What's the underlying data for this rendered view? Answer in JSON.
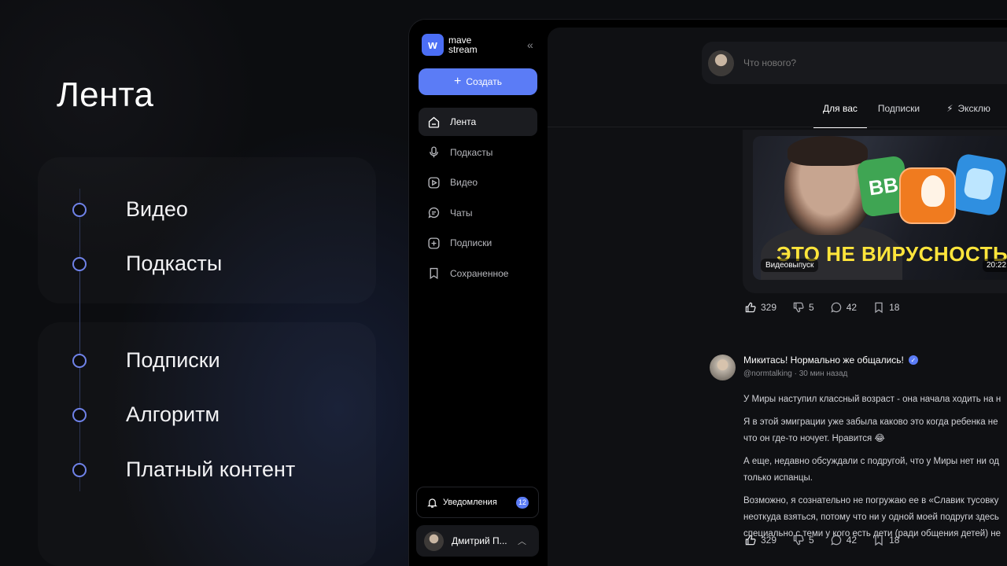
{
  "slide": {
    "title": "Лента",
    "items": [
      "Видео",
      "Подкасты",
      "Подписки",
      "Алгоритм",
      "Платный контент"
    ]
  },
  "app": {
    "logo": {
      "icon": "wave-logo-icon",
      "line1": "mave",
      "line2": "stream"
    },
    "collapse_label": "«",
    "create_label": "Создать",
    "nav": [
      {
        "label": "Лента",
        "icon": "home-icon",
        "active": true
      },
      {
        "label": "Подкасты",
        "icon": "microphone-icon"
      },
      {
        "label": "Видео",
        "icon": "play-icon"
      },
      {
        "label": "Чаты",
        "icon": "chat-icon"
      },
      {
        "label": "Подписки",
        "icon": "plus-square-icon"
      },
      {
        "label": "Сохраненное",
        "icon": "bookmark-icon"
      }
    ],
    "notifications": {
      "label": "Уведомления",
      "count": "12"
    },
    "user": {
      "name": "Дмитрий П..."
    },
    "accent": "#5b7cf6"
  },
  "feed": {
    "compose_placeholder": "Что нового?",
    "tabs": [
      "Для вас",
      "Подписки",
      "Эксклю"
    ],
    "video": {
      "headline": "ЭТО НЕ ВИРУСНОСТЬ",
      "badge": "Видеовыпуск",
      "duration": "20:22",
      "app_letters": "BB"
    },
    "video_actions": {
      "likes": "329",
      "dislikes": "5",
      "comments": "42",
      "saves": "18"
    },
    "post": {
      "author": "Микитась! Нормально же общались!",
      "handle": "@normtalking",
      "time": "30 мин назад",
      "paragraphs": [
        "У Миры наступил классный возраст - она начала ходить на н",
        "Я в этой эмиграции уже забыла каково это когда ребенка не\nчто он где-то ночует. Нравится 😂",
        "А еще, недавно обсуждали с подругой, что у Миры нет ни од\nтолько испанцы.",
        "Возможно, я сознательно не погружаю ее в «Славик тусовку\nнеоткуда взяться, потому что ни у одной моей подруги здесь\nспециально с теми у кого есть дети (ради общения детей) не"
      ]
    },
    "post_actions": {
      "likes": "329",
      "dislikes": "5",
      "comments": "42",
      "saves": "18"
    }
  }
}
